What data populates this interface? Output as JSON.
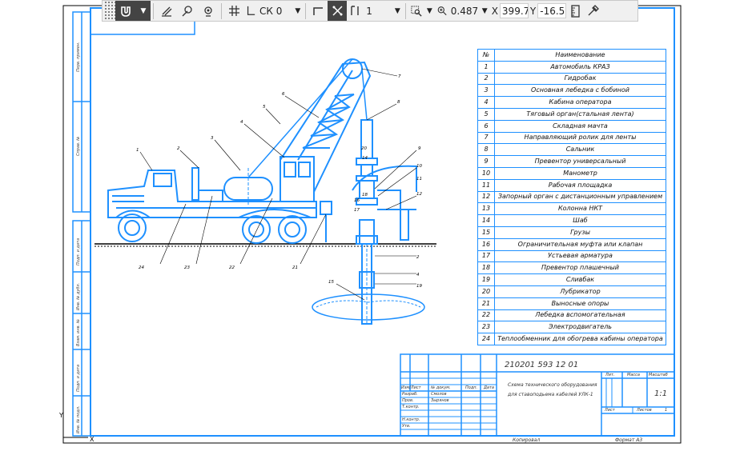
{
  "toolbar": {
    "cs_label": "СК 0",
    "step_value": "1",
    "zoom_value": "0.487",
    "x_label": "X",
    "x_value": "399.730",
    "y_label": "Y",
    "y_value": "-16.526"
  },
  "spec": {
    "header_num": "№",
    "header_name": "Наименование",
    "rows": [
      {
        "num": "1",
        "name": "Автомобиль КРАЗ"
      },
      {
        "num": "2",
        "name": "Гидробак"
      },
      {
        "num": "3",
        "name": "Основная лебедка с бобиной"
      },
      {
        "num": "4",
        "name": "Кабина оператора"
      },
      {
        "num": "5",
        "name": "Тяговый орган(стальная лента)"
      },
      {
        "num": "6",
        "name": "Складная мачта"
      },
      {
        "num": "7",
        "name": "Направляющий ролик для ленты"
      },
      {
        "num": "8",
        "name": "Сальник"
      },
      {
        "num": "9",
        "name": "Превентор универсальный"
      },
      {
        "num": "10",
        "name": "Манометр"
      },
      {
        "num": "11",
        "name": "Рабочая площадка"
      },
      {
        "num": "12",
        "name": "Запорный орган с дистанционным управлением"
      },
      {
        "num": "13",
        "name": "Колонна НКТ"
      },
      {
        "num": "14",
        "name": "Шаб"
      },
      {
        "num": "15",
        "name": "Грузы"
      },
      {
        "num": "16",
        "name": "Ограничительная муфта или клапан"
      },
      {
        "num": "17",
        "name": "Устьевая арматура"
      },
      {
        "num": "18",
        "name": "Превентор плашечный"
      },
      {
        "num": "19",
        "name": "Сливбак"
      },
      {
        "num": "20",
        "name": "Лубрикатор"
      },
      {
        "num": "21",
        "name": "Выносные опоры"
      },
      {
        "num": "22",
        "name": "Лебедка вспомогательная"
      },
      {
        "num": "23",
        "name": "Электродвигатель"
      },
      {
        "num": "24",
        "name": "Теплообменник для обогрева кабины оператора"
      }
    ]
  },
  "title_block": {
    "doc_code": "210201   593 12 01",
    "title_line1": "Схема технического оборудования",
    "title_line2": "для ставоподьема кабелей УЛК-1",
    "lit_label": "Лит.",
    "mass_label": "Масса",
    "scale_label": "Масштаб",
    "scale_value": "1:1",
    "sheet_label": "Лист",
    "sheets_label": "Листов",
    "sheets_value": "1",
    "rows_left": [
      {
        "role": "Изм/Лист",
        "name": "№ докум.",
        "sign": "Подп.",
        "date": "Дата"
      },
      {
        "role": "Разраб.",
        "name": "Смолов"
      },
      {
        "role": "Пров.",
        "name": "Зырянов"
      },
      {
        "role": "Т.контр.",
        "name": ""
      },
      {
        "role": "Н.контр.",
        "name": ""
      },
      {
        "role": "Утв.",
        "name": ""
      }
    ],
    "copied": "Копировал",
    "format": "Формат   А3"
  },
  "side_stamps": [
    "Перв. примен.",
    "Справ. №",
    "Подп. и дата",
    "Инв. № дубл.",
    "Взам. инв. №",
    "Подп. и дата",
    "Инв. № подл."
  ],
  "callouts": [
    "1",
    "2",
    "3",
    "4",
    "5",
    "6",
    "7",
    "8",
    "9",
    "10",
    "11",
    "12",
    "14",
    "15",
    "16",
    "17",
    "18",
    "19",
    "20",
    "21",
    "22",
    "23",
    "24",
    "2",
    "4",
    "5"
  ],
  "colors": {
    "line": "#1e90ff",
    "frame": "#000000",
    "toolbar_bg": "#f0f0f0"
  }
}
